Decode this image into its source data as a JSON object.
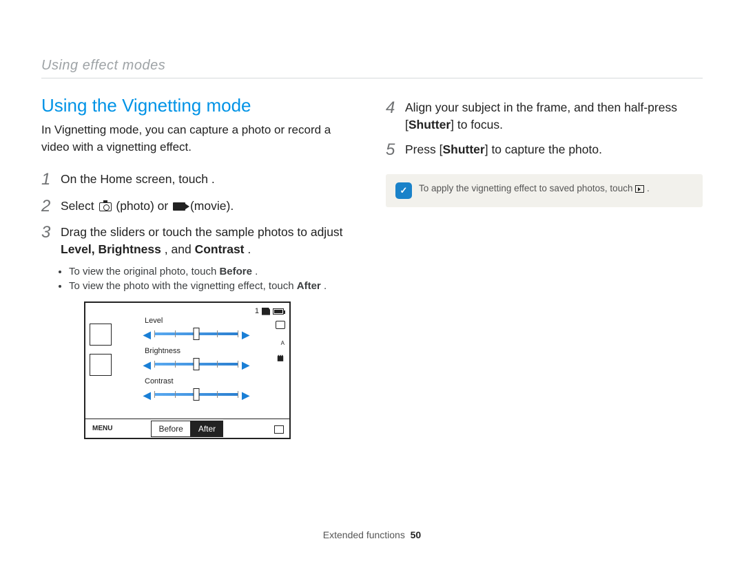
{
  "header": {
    "section": "Using effect modes"
  },
  "title": "Using the Vignetting mode",
  "intro": "In Vignetting mode, you can capture a photo or record a video with a vignetting effect.",
  "steps_left": {
    "s1": {
      "num": "1",
      "text": "On the Home screen, touch       ."
    },
    "s2": {
      "num": "2",
      "pre": "Select ",
      "photo_label": " (photo) or ",
      "movie_label": " (movie)."
    },
    "s3": {
      "num": "3",
      "line1": "Drag the sliders or touch the sample photos to adjust ",
      "bold": "Level, Brightness",
      "mid": ", and ",
      "bold2": "Contrast",
      "end": "."
    },
    "bullets": {
      "b1_pre": "To view the original photo, touch ",
      "b1_bold": "Before",
      "b1_end": ".",
      "b2_pre": "To view the photo with the vignetting effect, touch ",
      "b2_bold": "After",
      "b2_end": "."
    }
  },
  "lcd": {
    "count": "1",
    "sliders": {
      "level": "Level",
      "brightness": "Brightness",
      "contrast": "Contrast"
    },
    "menu": "MENU",
    "before": "Before",
    "after": "After",
    "flash_sup": "A"
  },
  "steps_right": {
    "s4": {
      "num": "4",
      "pre": "Align your subject in the frame, and then half-press [",
      "bold": "Shutter",
      "post": "] to focus."
    },
    "s5": {
      "num": "5",
      "pre": "Press [",
      "bold": "Shutter",
      "post": "] to capture the photo."
    }
  },
  "note": {
    "icon": "✓",
    "text": "To apply the vignetting effect to saved photos, touch ",
    "end": "."
  },
  "footer": {
    "label": "Extended functions",
    "page": "50"
  }
}
